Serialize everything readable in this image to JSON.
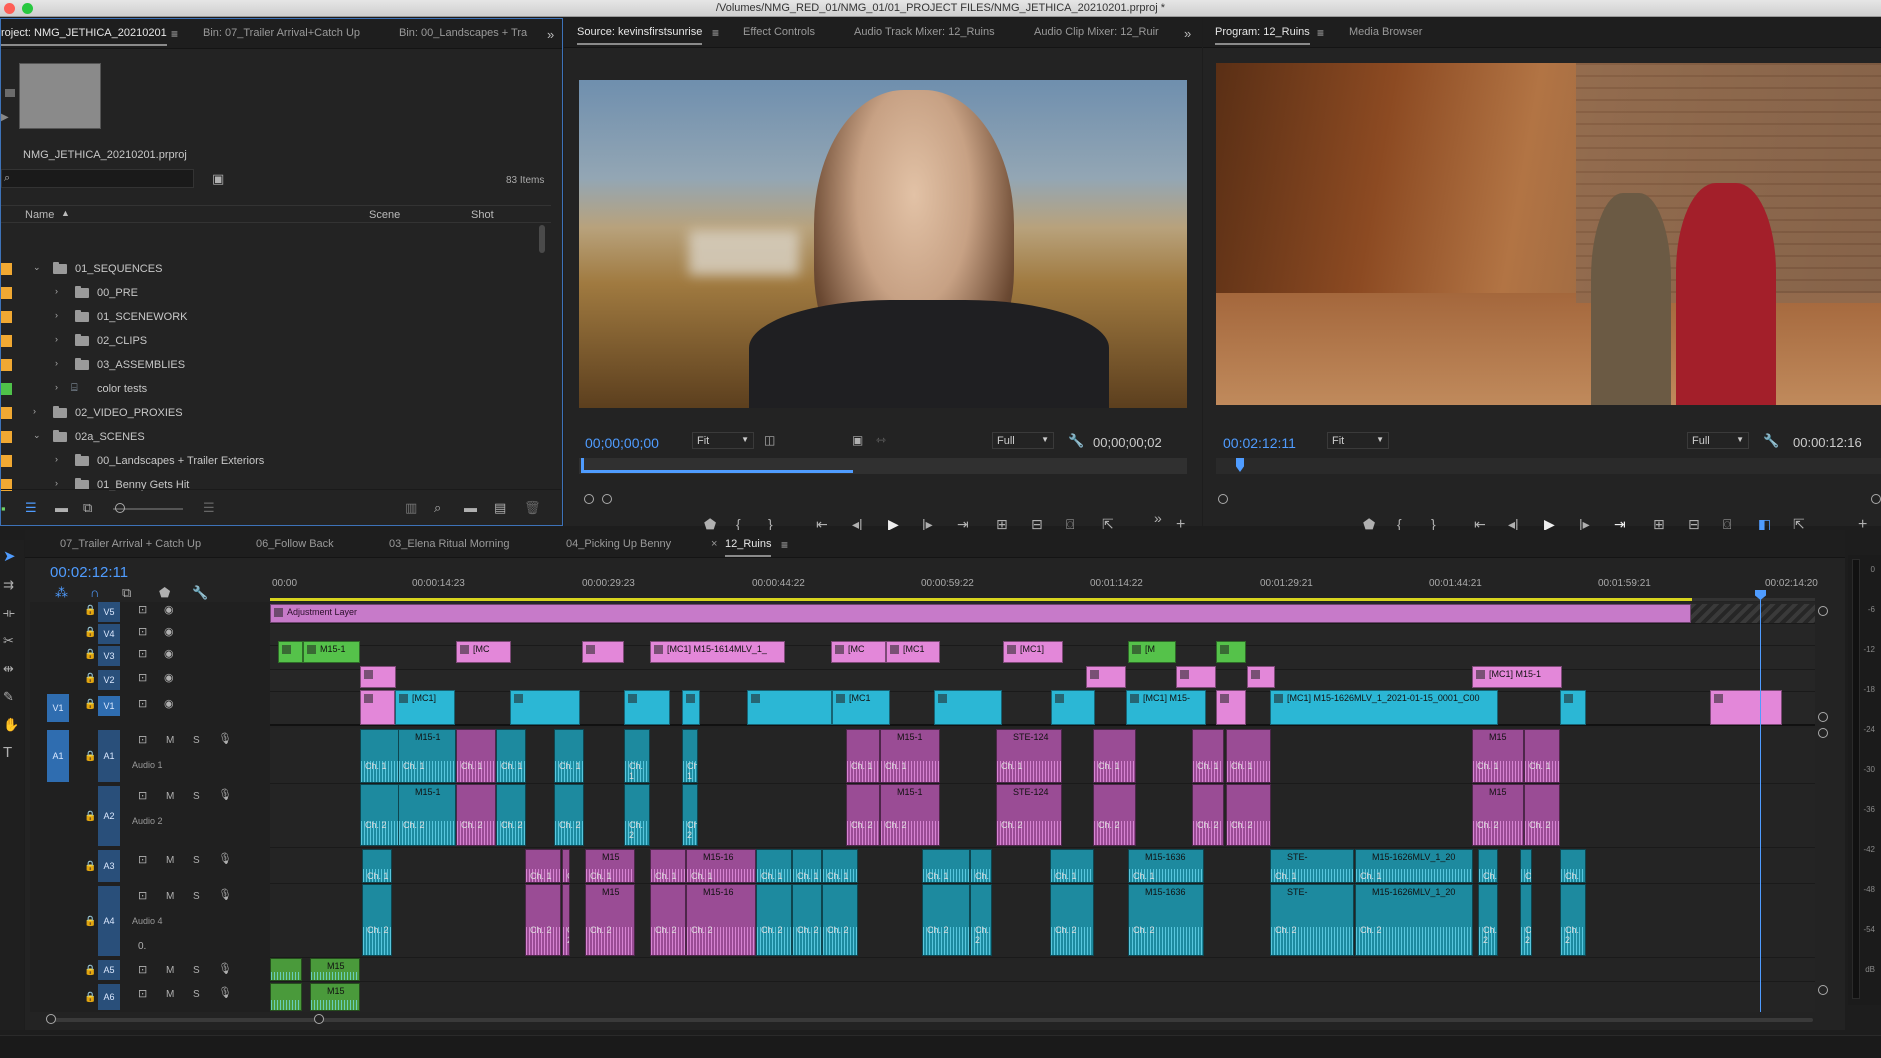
{
  "window": {
    "title": "/Volumes/NMG_RED_01/NMG_01/01_PROJECT FILES/NMG_JETHICA_20210201.prproj *"
  },
  "project_panel": {
    "tabs": [
      "roject: NMG_JETHICA_20210201",
      "Bin: 07_Trailer Arrival+Catch Up",
      "Bin: 00_Landscapes + Tra"
    ],
    "project_file": "NMG_JETHICA_20210201.prproj",
    "item_count": "83 Items",
    "columns": [
      "Name",
      "Scene",
      "Shot"
    ],
    "rows": [
      {
        "label": "01_SEQUENCES",
        "type": "folder",
        "expanded": true,
        "indent": 0,
        "color": "#f0a832"
      },
      {
        "label": "00_PRE",
        "type": "folder",
        "expanded": false,
        "indent": 1,
        "color": "#f0a832"
      },
      {
        "label": "01_SCENEWORK",
        "type": "folder",
        "expanded": false,
        "indent": 1,
        "color": "#f0a832"
      },
      {
        "label": "02_CLIPS",
        "type": "folder",
        "expanded": false,
        "indent": 1,
        "color": "#f0a832"
      },
      {
        "label": "03_ASSEMBLIES",
        "type": "folder",
        "expanded": false,
        "indent": 1,
        "color": "#f0a832"
      },
      {
        "label": "color tests",
        "type": "sequence",
        "expanded": false,
        "indent": 1,
        "color": "#4fc24a"
      },
      {
        "label": "02_VIDEO_PROXIES",
        "type": "folder",
        "expanded": false,
        "indent": 0,
        "color": "#f0a832"
      },
      {
        "label": "02a_SCENES",
        "type": "folder",
        "expanded": true,
        "indent": 0,
        "color": "#f0a832"
      },
      {
        "label": "00_Landscapes + Trailer Exteriors",
        "type": "folder",
        "expanded": false,
        "indent": 1,
        "color": "#f0a832"
      },
      {
        "label": "01_Benny Gets Hit",
        "type": "folder",
        "expanded": false,
        "indent": 1,
        "color": "#f0a832"
      }
    ]
  },
  "source_monitor": {
    "tabs": [
      "Source: kevinsfirstsunrise",
      "Effect Controls",
      "Audio Track Mixer: 12_Ruins",
      "Audio Clip Mixer: 12_Ruir"
    ],
    "timecode_in": "00;00;00;00",
    "fit": "Fit",
    "quality": "Full",
    "timecode_dur": "00;00;00;02"
  },
  "program_monitor": {
    "tabs": [
      "Program: 12_Ruins",
      "Media Browser"
    ],
    "timecode_in": "00:02:12:11",
    "fit": "Fit",
    "quality": "Full",
    "timecode_dur": "00:00:12:16"
  },
  "timeline": {
    "tabs": [
      "07_Trailer Arrival + Catch Up",
      "06_Follow Back",
      "03_Elena Ritual Morning",
      "04_Picking Up Benny",
      "12_Ruins"
    ],
    "active_tab": "12_Ruins",
    "timecode": "00:02:12:11",
    "ruler": [
      "00:00",
      "00:00:14:23",
      "00:00:29:23",
      "00:00:44:22",
      "00:00:59:22",
      "00:01:14:22",
      "00:01:29:21",
      "00:01:44:21",
      "00:01:59:21",
      "00:02:14:20"
    ],
    "adjustment_layer": "Adjustment Layer",
    "video_tracks": [
      "V5",
      "V4",
      "V3",
      "V2",
      "V1"
    ],
    "audio_tracks": [
      {
        "id": "A1",
        "name": "Audio 1"
      },
      {
        "id": "A2",
        "name": "Audio 2"
      },
      {
        "id": "A3",
        "name": ""
      },
      {
        "id": "A4",
        "name": "Audio 4"
      },
      {
        "id": "A5",
        "name": ""
      },
      {
        "id": "A6",
        "name": ""
      }
    ],
    "source_patch_v": "V1",
    "source_patch_a": "A1",
    "track_buttons": {
      "mute": "M",
      "solo": "S"
    },
    "master_level": "0.",
    "clip_labels": {
      "v3_1": "M15-1",
      "v3_2": "[MC",
      "v3_3": "[MC1] M15-1614MLV_1_",
      "v3_4": "[MC",
      "v3_5": "[MC1",
      "v3_6": "[MC1]",
      "v3_7": "[M",
      "v2_1": "[MC1] M15-1",
      "v1_1": "[MC1]",
      "v1_2": "[MC1",
      "v1_3": "[MC1] M15-",
      "v1_4": "[MC1] M15-1626MLV_1_2021-01-15_0001_C00",
      "a_m15": "M15-1",
      "a_ste": "STE-124",
      "a_m15b": "M15",
      "a_m1516": "M15-16",
      "a_1636": "M15-1636",
      "a_ste2": "STE-",
      "a_1626": "M15-1626MLV_1_20",
      "ch1": "Ch. 1",
      "ch2": "Ch. 2",
      "a5_clip": "M15"
    }
  },
  "meter_scale": [
    "0",
    "-6",
    "-12",
    "-18",
    "-24",
    "-30",
    "-36",
    "-42",
    "-48",
    "-54",
    "dB"
  ]
}
